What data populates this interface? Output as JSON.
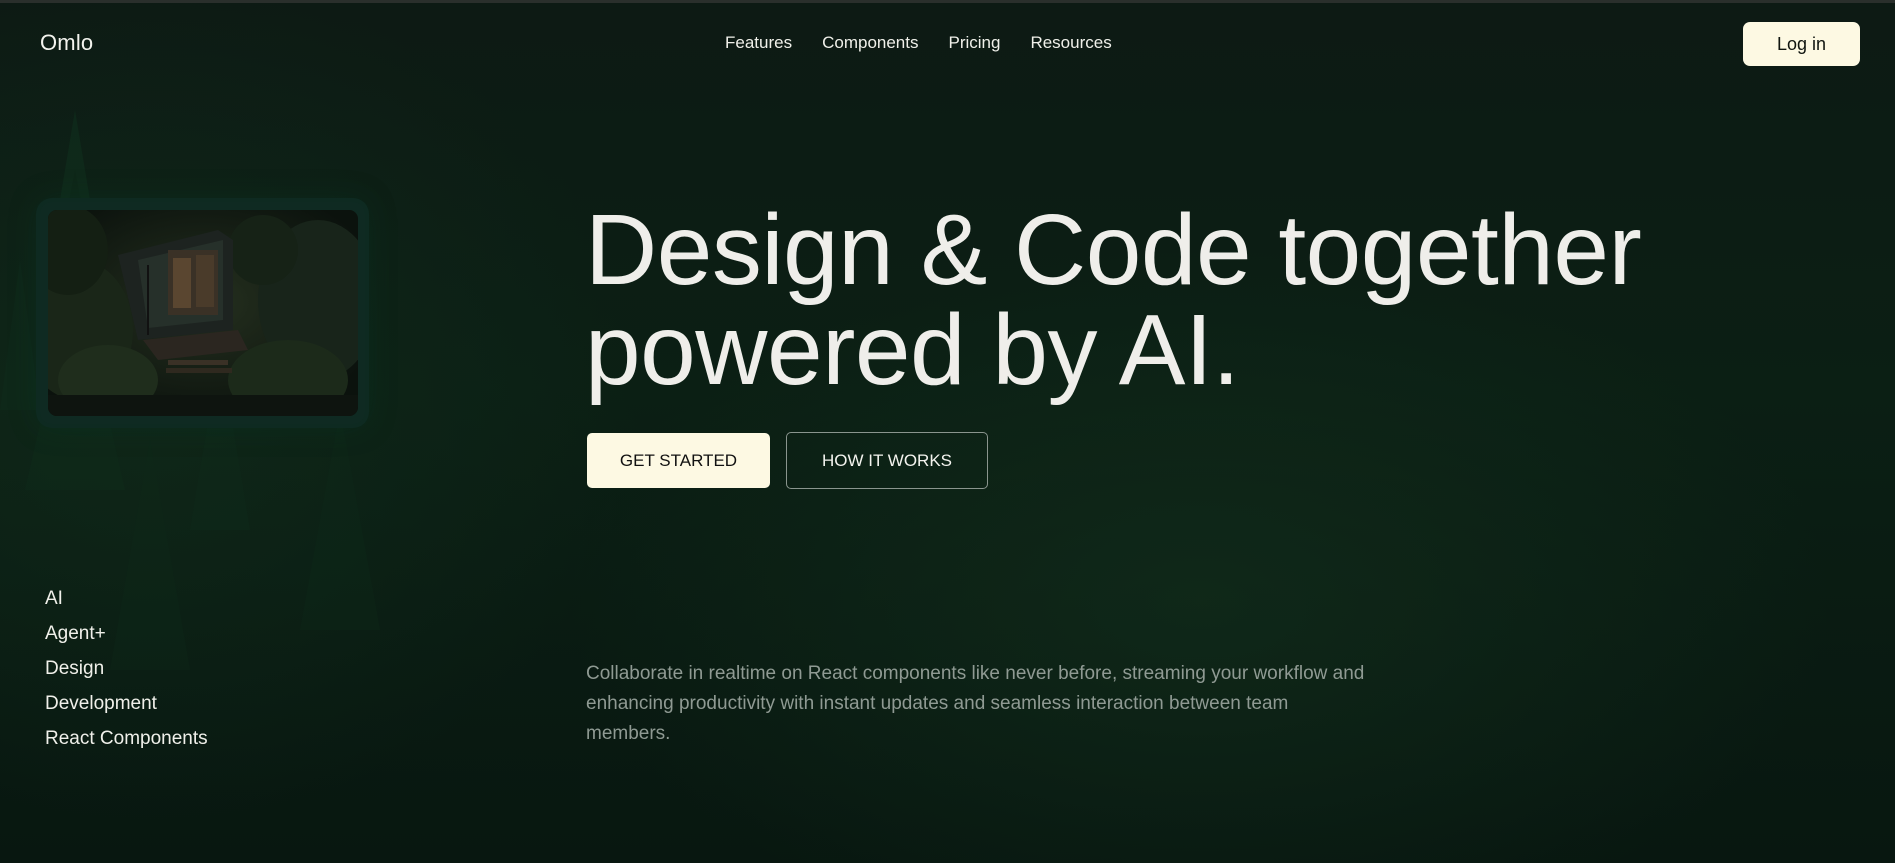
{
  "header": {
    "logo": "Omlo",
    "nav": [
      "Features",
      "Components",
      "Pricing",
      "Resources"
    ],
    "login_label": "Log in"
  },
  "hero": {
    "headline_line1": "Design & Code together",
    "headline_line2": "powered by AI.",
    "primary_cta": "GET STARTED",
    "secondary_cta": "HOW IT WORKS",
    "description": "Collaborate in realtime on React components like never before, streaming your workflow and enhancing productivity with instant updates and seamless interaction between team members."
  },
  "side_list": [
    "AI",
    "Agent+",
    "Design",
    "Development",
    "React Components"
  ],
  "colors": {
    "background": "#0b1a12",
    "accent_cream": "#fdf9e3",
    "text_primary": "#efeeea",
    "text_muted": "#8f9a93"
  },
  "icons": {
    "hero_image": "forest-cabin-image"
  }
}
